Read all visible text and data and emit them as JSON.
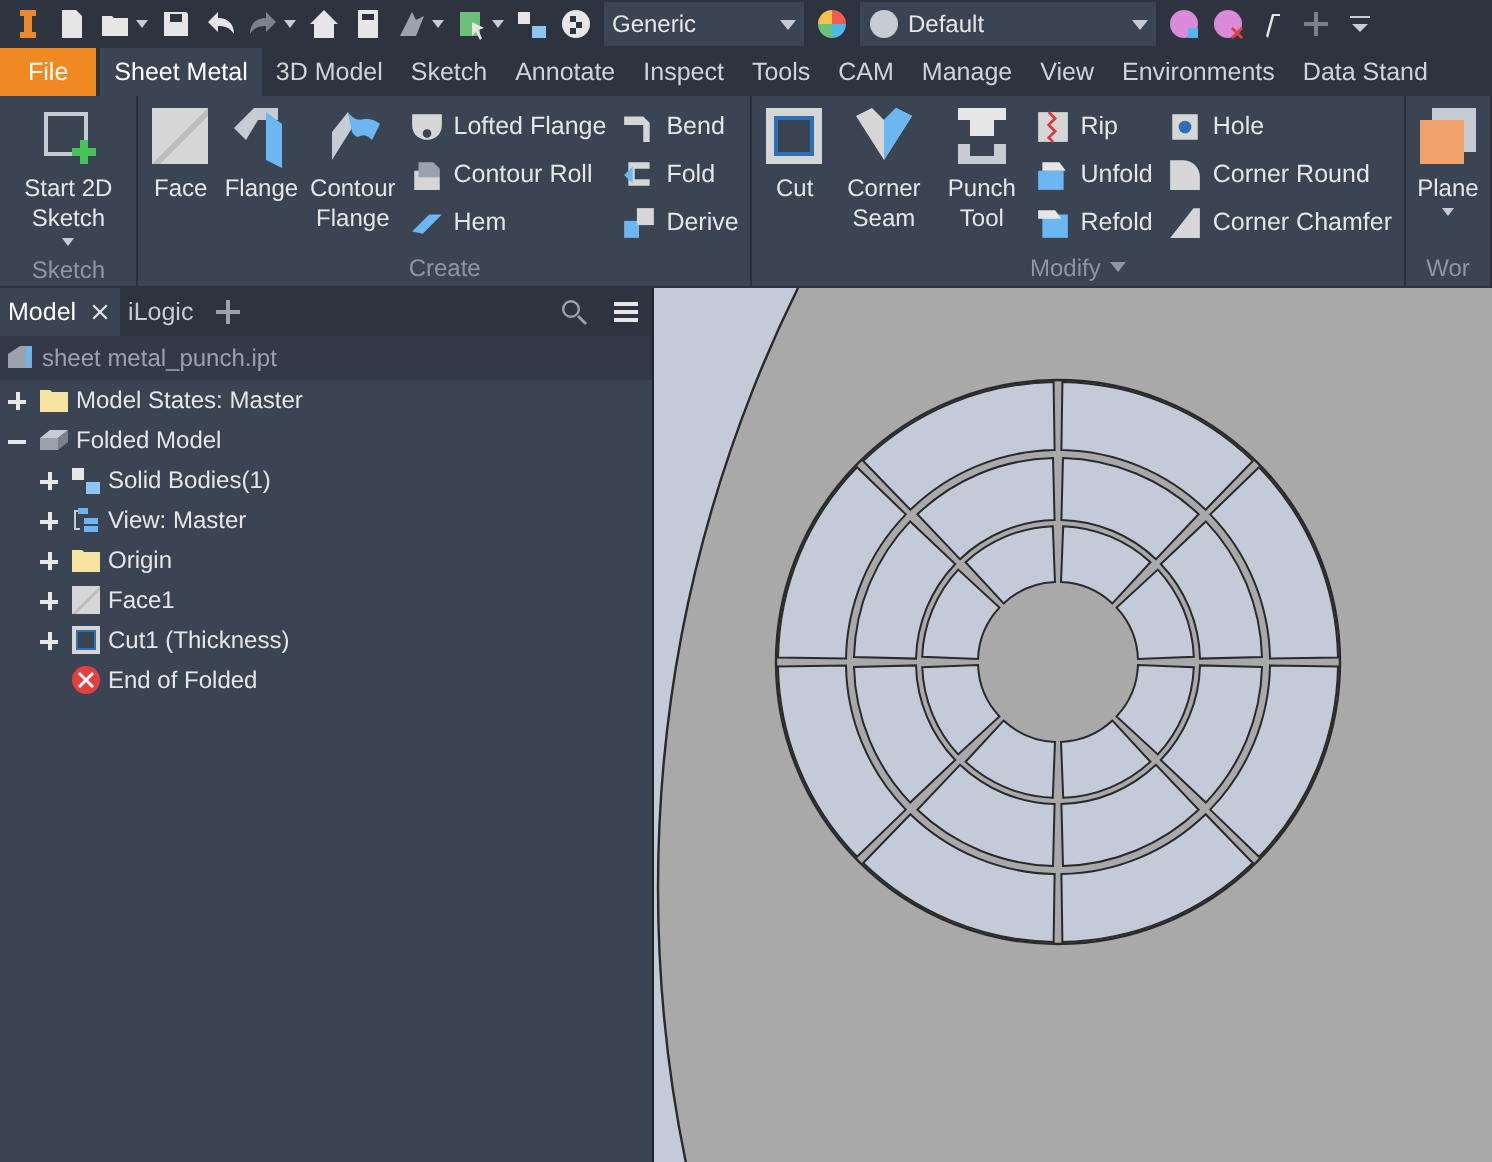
{
  "quick_access": {
    "material": "Generic",
    "appearance": "Default"
  },
  "tabs": [
    {
      "label": "File",
      "kind": "file",
      "selected": false
    },
    {
      "label": "Sheet Metal",
      "kind": "tab",
      "selected": true
    },
    {
      "label": "3D Model",
      "kind": "tab",
      "selected": false
    },
    {
      "label": "Sketch",
      "kind": "tab",
      "selected": false
    },
    {
      "label": "Annotate",
      "kind": "tab",
      "selected": false
    },
    {
      "label": "Inspect",
      "kind": "tab",
      "selected": false
    },
    {
      "label": "Tools",
      "kind": "tab",
      "selected": false
    },
    {
      "label": "CAM",
      "kind": "tab",
      "selected": false
    },
    {
      "label": "Manage",
      "kind": "tab",
      "selected": false
    },
    {
      "label": "View",
      "kind": "tab",
      "selected": false
    },
    {
      "label": "Environments",
      "kind": "tab",
      "selected": false
    },
    {
      "label": "Data Stand",
      "kind": "tab",
      "selected": false
    }
  ],
  "ribbon": [
    {
      "title": "Sketch",
      "menu": false,
      "groups": [
        {
          "kind": "large",
          "buttons": [
            {
              "label": "Start 2D Sketch",
              "menu": true
            }
          ]
        }
      ]
    },
    {
      "title": "Create",
      "menu": false,
      "groups": [
        {
          "kind": "large",
          "buttons": [
            {
              "label": "Face",
              "menu": false
            },
            {
              "label": "Flange",
              "menu": false
            },
            {
              "label": "Contour Flange",
              "menu": false
            }
          ]
        },
        {
          "kind": "small",
          "buttons": [
            {
              "label": "Lofted Flange"
            },
            {
              "label": "Contour Roll"
            },
            {
              "label": "Hem"
            }
          ]
        },
        {
          "kind": "small",
          "buttons": [
            {
              "label": "Bend"
            },
            {
              "label": "Fold"
            },
            {
              "label": "Derive"
            }
          ]
        }
      ]
    },
    {
      "title": "Modify",
      "menu": true,
      "groups": [
        {
          "kind": "large",
          "buttons": [
            {
              "label": "Cut",
              "menu": false
            },
            {
              "label": "Corner Seam",
              "menu": false
            },
            {
              "label": "Punch Tool",
              "menu": false
            }
          ]
        },
        {
          "kind": "small",
          "buttons": [
            {
              "label": "Rip"
            },
            {
              "label": "Unfold"
            },
            {
              "label": "Refold"
            }
          ]
        },
        {
          "kind": "small",
          "buttons": [
            {
              "label": "Hole"
            },
            {
              "label": "Corner Round"
            },
            {
              "label": "Corner Chamfer"
            }
          ]
        }
      ]
    },
    {
      "title": "Wor",
      "menu": false,
      "groups": [
        {
          "kind": "large",
          "buttons": [
            {
              "label": "Plane",
              "menu": true
            }
          ]
        }
      ]
    }
  ],
  "browser": {
    "tabs": [
      {
        "label": "Model",
        "selected": true,
        "closable": true
      },
      {
        "label": "iLogic",
        "selected": false,
        "closable": false
      }
    ],
    "file": "sheet metal_punch.ipt",
    "tree": [
      {
        "label": "Model States: Master",
        "kind": "folder",
        "expanded": false
      },
      {
        "label": "Folded Model",
        "kind": "model",
        "expanded": true,
        "children": [
          {
            "label": "Solid Bodies(1)",
            "kind": "bodies",
            "expanded": false
          },
          {
            "label": "View: Master",
            "kind": "view",
            "expanded": false
          },
          {
            "label": "Origin",
            "kind": "folder",
            "expanded": false
          },
          {
            "label": "Face1",
            "kind": "face",
            "expanded": false
          },
          {
            "label": "Cut1 (Thickness)",
            "kind": "cut",
            "expanded": false
          },
          {
            "label": "End of Folded",
            "kind": "end"
          }
        ]
      }
    ]
  }
}
